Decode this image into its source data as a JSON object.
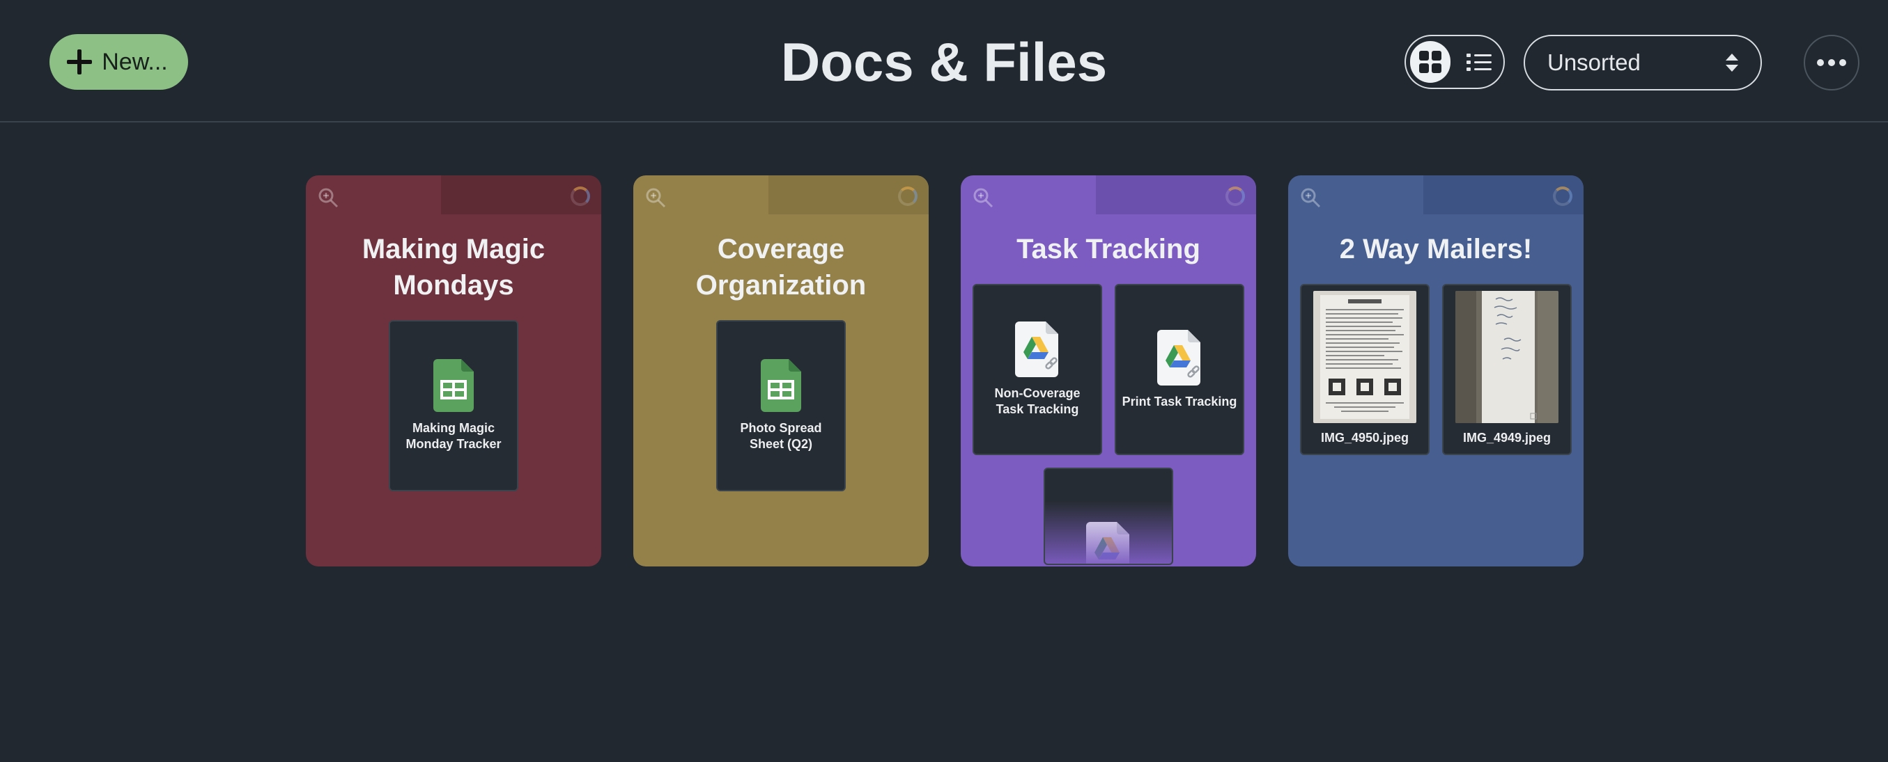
{
  "header": {
    "new_label": "New...",
    "title": "Docs & Files",
    "sort_value": "Unsorted"
  },
  "icons": {
    "plus": "plus-icon",
    "grid": "grid-view-icon",
    "list": "list-view-icon",
    "more": "ellipsis-icon",
    "zoom": "zoom-in-icon",
    "sheets": "google-sheets-icon",
    "drive": "google-drive-link-icon"
  },
  "colors": {
    "background": "#212830",
    "new_button": "#8cc084",
    "folder_red": "#6e323e",
    "folder_gold": "#94814a",
    "folder_purple": "#7c5cc1",
    "folder_blue": "#465e90"
  },
  "folders": [
    {
      "title": "Making Magic Mondays",
      "items": [
        {
          "label": "Making Magic Monday Tracker",
          "type": "sheets"
        }
      ]
    },
    {
      "title": "Coverage Organization",
      "items": [
        {
          "label": "Photo Spread Sheet (Q2)",
          "type": "sheets"
        }
      ]
    },
    {
      "title": "Task Tracking",
      "items": [
        {
          "label": "Non-Coverage Task Tracking",
          "type": "drive"
        },
        {
          "label": "Print Task Tracking",
          "type": "drive"
        },
        {
          "label": "",
          "type": "drive"
        }
      ]
    },
    {
      "title": "2 Way Mailers!",
      "items": [
        {
          "label": "IMG_4950.jpeg",
          "type": "photo"
        },
        {
          "label": "IMG_4949.jpeg",
          "type": "photo"
        }
      ]
    }
  ]
}
